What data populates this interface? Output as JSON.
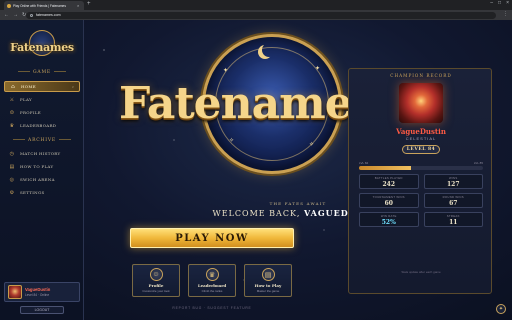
{
  "browser": {
    "tab_title": "Play Online with Friends | Fatenames",
    "url": "fatenames.com"
  },
  "sidebar": {
    "logo": "Fatenames",
    "game_section": "GAME",
    "archive_section": "ARCHIVE",
    "items": [
      {
        "label": "HOME",
        "icon": "home-icon"
      },
      {
        "label": "PLAY",
        "icon": "swords-icon"
      },
      {
        "label": "PROFILE",
        "icon": "user-icon"
      },
      {
        "label": "LEADERBOARD",
        "icon": "trophy-icon"
      },
      {
        "label": "MATCH HISTORY",
        "icon": "history-icon"
      },
      {
        "label": "HOW TO PLAY",
        "icon": "book-icon"
      },
      {
        "label": "SWICH ARENA",
        "icon": "arena-icon"
      },
      {
        "label": "SETTINGS",
        "icon": "gear-icon"
      }
    ],
    "profile": {
      "name": "VagueDustin",
      "sub": "Level 84 · Online"
    },
    "logout": "LOGOUT"
  },
  "main": {
    "logo": "Fatenames",
    "tagline": "THE FATES AWAIT",
    "welcome_prefix": "WELCOME BACK,",
    "welcome_name": "VAGUEDUSTIN",
    "play_button": "PLAY NOW",
    "quick_cards": [
      {
        "title": "Profile",
        "sub": "Customize your look",
        "icon": "user-icon"
      },
      {
        "title": "Leaderboard",
        "sub": "Climb the ranks",
        "icon": "trophy-icon"
      },
      {
        "title": "How to Play",
        "sub": "Master the game",
        "icon": "book-icon"
      }
    ],
    "footer": "REPORT BUG · SUGGEST FEATURE"
  },
  "champion": {
    "header": "CHAMPION RECORD",
    "name": "VagueDustin",
    "class": "CELESTIAL",
    "level": "LEVEL 84",
    "xp_left": "LVL 84",
    "xp_right": "LVL 85",
    "xp_fraction": 0.42,
    "stats": [
      {
        "label": "BATTLES PLAYED",
        "value": "242",
        "highlight": false
      },
      {
        "label": "WINS",
        "value": "127",
        "highlight": false
      },
      {
        "label": "TOURNAMENT WINS",
        "value": "60",
        "highlight": false
      },
      {
        "label": "ROUND WINS",
        "value": "67",
        "highlight": false
      },
      {
        "label": "WIN RATE",
        "value": "52%",
        "highlight": true
      },
      {
        "label": "STREAK",
        "value": "11",
        "highlight": false
      }
    ],
    "footer": "Stats update after each game"
  },
  "colors": {
    "accent_gold": "#f0b83a",
    "champion_red": "#ff5a44",
    "highlight_cyan": "#6fe0ff"
  }
}
